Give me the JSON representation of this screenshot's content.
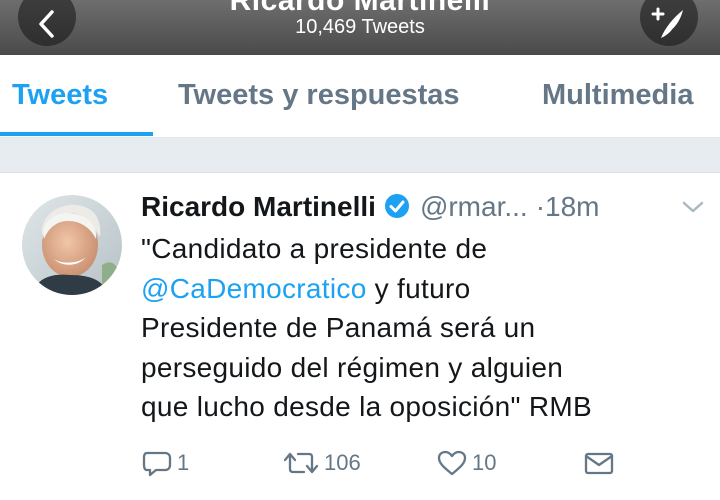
{
  "header": {
    "title": "Ricardo Martinelli",
    "tweet_count": "10,469 Tweets"
  },
  "tabs": [
    {
      "label": "Tweets"
    },
    {
      "label": "Tweets y respuestas"
    },
    {
      "label": "Multimedia"
    }
  ],
  "tweet": {
    "name": "Ricardo Martinelli",
    "handle": "@rmar...",
    "separator": "·",
    "time": "18m",
    "text_lines": [
      "\"Candidato a presidente de",
      "@CaDemocratico",
      " y futuro",
      "Presidente de Panamá será un",
      "perseguido del régimen y alguien",
      "que lucho desde la oposición\" RMB"
    ],
    "replies": "1",
    "retweets": "106",
    "likes": "10"
  },
  "colors": {
    "accent": "#1da1f2",
    "muted": "#657786",
    "divider_bg": "#e6ecf0"
  },
  "icons": [
    "back-arrow-icon",
    "compose-tweet-icon",
    "verified-badge-icon",
    "chevron-down-icon",
    "reply-icon",
    "retweet-icon",
    "like-icon",
    "direct-message-icon"
  ]
}
